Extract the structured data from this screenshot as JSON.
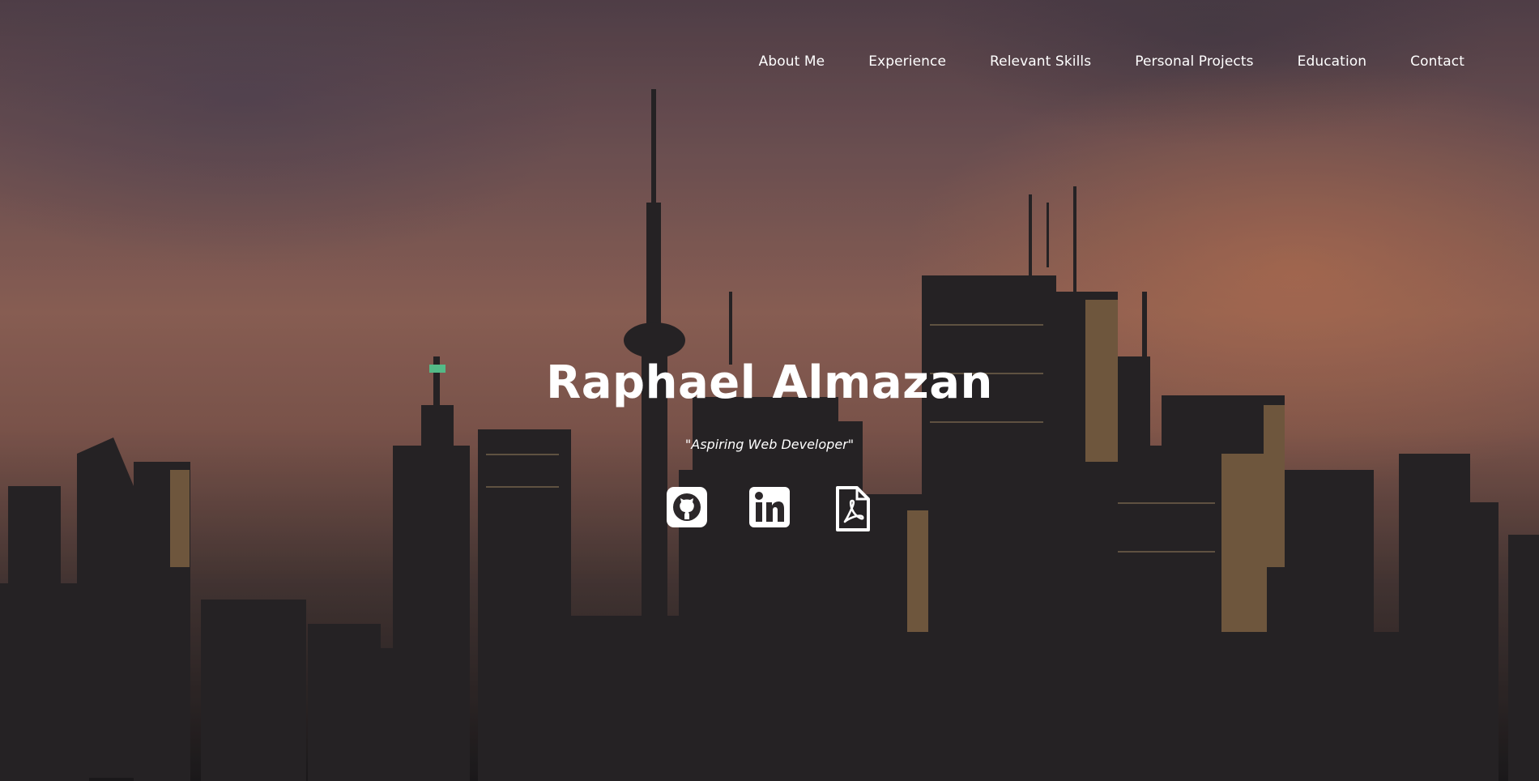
{
  "nav": {
    "items": [
      {
        "label": "About Me"
      },
      {
        "label": "Experience"
      },
      {
        "label": "Relevant Skills"
      },
      {
        "label": "Personal Projects"
      },
      {
        "label": "Education"
      },
      {
        "label": "Contact"
      }
    ]
  },
  "hero": {
    "name": "Raphael Almazan",
    "tagline": "\"Aspiring Web Developer\""
  },
  "socials": [
    {
      "icon": "github-icon"
    },
    {
      "icon": "linkedin-icon"
    },
    {
      "icon": "pdf-file-icon"
    }
  ],
  "colors": {
    "text": "#ffffff",
    "sky_top": "#5a4650",
    "sky_glow": "#d68056",
    "buildings": "#2a2628"
  }
}
